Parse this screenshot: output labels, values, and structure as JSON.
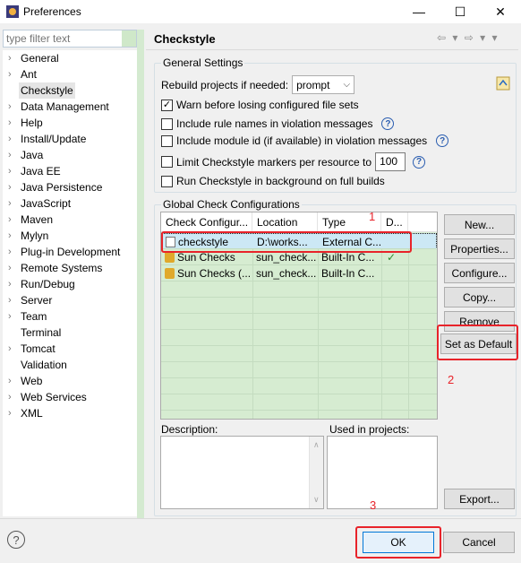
{
  "window": {
    "title": "Preferences",
    "minimize": "—",
    "maximize": "☐",
    "close": "✕"
  },
  "filter": {
    "placeholder": "type filter text"
  },
  "tree": [
    {
      "label": "General",
      "expandable": true
    },
    {
      "label": "Ant",
      "expandable": true
    },
    {
      "label": "Checkstyle",
      "expandable": false,
      "selected": true
    },
    {
      "label": "Data Management",
      "expandable": true
    },
    {
      "label": "Help",
      "expandable": true
    },
    {
      "label": "Install/Update",
      "expandable": true
    },
    {
      "label": "Java",
      "expandable": true
    },
    {
      "label": "Java EE",
      "expandable": true
    },
    {
      "label": "Java Persistence",
      "expandable": true
    },
    {
      "label": "JavaScript",
      "expandable": true
    },
    {
      "label": "Maven",
      "expandable": true
    },
    {
      "label": "Mylyn",
      "expandable": true
    },
    {
      "label": "Plug-in Development",
      "expandable": true
    },
    {
      "label": "Remote Systems",
      "expandable": true
    },
    {
      "label": "Run/Debug",
      "expandable": true
    },
    {
      "label": "Server",
      "expandable": true
    },
    {
      "label": "Team",
      "expandable": true
    },
    {
      "label": "Terminal",
      "expandable": false
    },
    {
      "label": "Tomcat",
      "expandable": true
    },
    {
      "label": "Validation",
      "expandable": false
    },
    {
      "label": "Web",
      "expandable": true
    },
    {
      "label": "Web Services",
      "expandable": true
    },
    {
      "label": "XML",
      "expandable": true
    }
  ],
  "page": {
    "title": "Checkstyle",
    "nav_arrows": "⇦ ▾ ⇨ ▾ ▾"
  },
  "general": {
    "group_label": "General Settings",
    "rebuild_label": "Rebuild projects if needed:",
    "rebuild_value": "prompt",
    "warn_label": "Warn before losing configured file sets",
    "warn_checked": true,
    "include_rule_label": "Include rule names in violation messages",
    "include_module_label": "Include module id (if available) in violation messages",
    "limit_label": "Limit Checkstyle markers per resource to",
    "limit_value": "100",
    "background_label": "Run Checkstyle in background on full builds"
  },
  "global": {
    "group_label": "Global Check Configurations",
    "columns": [
      "Check Configur...",
      "Location",
      "Type",
      "D..."
    ],
    "rows": [
      {
        "name": "checkstyle",
        "location": "D:\\works...",
        "type": "External C...",
        "default": "",
        "icon": "file-icon"
      },
      {
        "name": "Sun Checks",
        "location": "sun_check...",
        "type": "Built-In C...",
        "default": "✓",
        "icon": "lock-icon"
      },
      {
        "name": "Sun Checks (...",
        "location": "sun_check...",
        "type": "Built-In C...",
        "default": "",
        "icon": "lock-icon"
      }
    ],
    "buttons": {
      "new": "New...",
      "properties": "Properties...",
      "configure": "Configure...",
      "copy": "Copy...",
      "remove": "Remove",
      "set_default": "Set as Default",
      "export": "Export..."
    },
    "description_label": "Description:",
    "used_in_label": "Used in projects:"
  },
  "annotations": {
    "one": "1",
    "two": "2",
    "three": "3"
  },
  "footer": {
    "ok": "OK",
    "cancel": "Cancel",
    "help": "?"
  },
  "colors": {
    "highlight_red": "#e8232a",
    "table_bg": "#d6ecd1",
    "selection": "#cce8f5"
  }
}
